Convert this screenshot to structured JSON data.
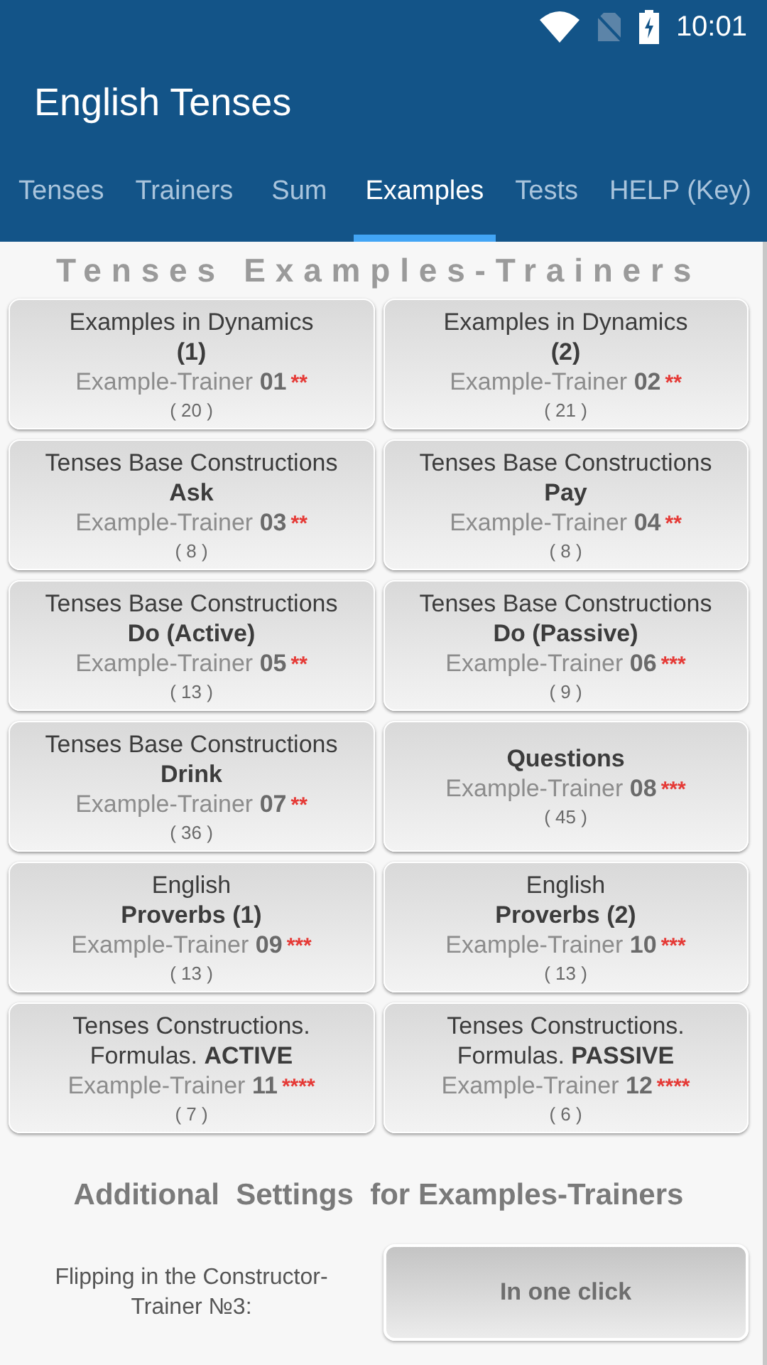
{
  "status_bar": {
    "time": "10:01"
  },
  "app_bar": {
    "title": "English Tenses"
  },
  "tabs": [
    {
      "label": "Tenses",
      "selected": false
    },
    {
      "label": "Trainers",
      "selected": false
    },
    {
      "label": "Sum",
      "selected": false
    },
    {
      "label": "Examples",
      "selected": true
    },
    {
      "label": "Tests",
      "selected": false
    },
    {
      "label": "HELP (Key)",
      "selected": false
    }
  ],
  "heading": "Tenses Examples-Trainers",
  "cards": [
    {
      "title": "Examples in Dynamics\n**(1)**",
      "trainer": "Example-Trainer **01**",
      "rating": "**",
      "count": "( 20 )"
    },
    {
      "title": "Examples in Dynamics\n**(2)**",
      "trainer": "Example-Trainer **02**",
      "rating": "**",
      "count": "( 21 )"
    },
    {
      "title": "Tenses Base Constructions\n**Ask**",
      "trainer": "Example-Trainer **03**",
      "rating": "**",
      "count": "( 8 )"
    },
    {
      "title": "Tenses Base Constructions\n**Pay**",
      "trainer": "Example-Trainer **04**",
      "rating": "**",
      "count": "( 8 )"
    },
    {
      "title": "Tenses Base Constructions\n**Do (Active)**",
      "trainer": "Example-Trainer **05**",
      "rating": "**",
      "count": "( 13 )"
    },
    {
      "title": "Tenses Base Constructions\n**Do (Passive)**",
      "trainer": "Example-Trainer **06**",
      "rating": "***",
      "count": "( 9 )"
    },
    {
      "title": "Tenses Base Constructions\n**Drink**",
      "trainer": "Example-Trainer **07**",
      "rating": "**",
      "count": "( 36 )"
    },
    {
      "title": "**Questions**",
      "trainer": "Example-Trainer **08**",
      "rating": "***",
      "count": "( 45 )"
    },
    {
      "title": "English\n**Proverbs (1)**",
      "trainer": "Example-Trainer **09**",
      "rating": "***",
      "count": "( 13 )"
    },
    {
      "title": "English\n**Proverbs (2)**",
      "trainer": "Example-Trainer **10**",
      "rating": "***",
      "count": "( 13 )"
    },
    {
      "title": "Tenses Constructions.\nFormulas. **ACTIVE**",
      "trainer": "Example-Trainer **11**",
      "rating": "****",
      "count": "( 7 )"
    },
    {
      "title": "Tenses Constructions.\nFormulas. **PASSIVE**",
      "trainer": "Example-Trainer **12**",
      "rating": "****",
      "count": "( 6 )"
    }
  ],
  "settings": {
    "heading": "Additional  Settings  for Examples-Trainers",
    "rows": [
      {
        "label": "Flipping in the Constructor-Trainer №3:",
        "button": "In one click"
      }
    ]
  }
}
